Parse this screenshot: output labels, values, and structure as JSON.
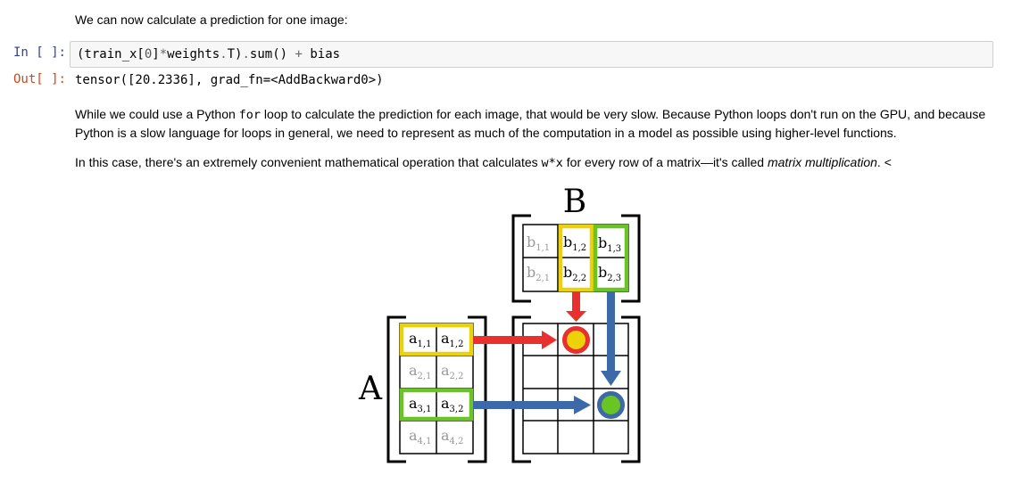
{
  "md1": {
    "text": "We can now calculate a prediction for one image:"
  },
  "cell_in": {
    "prompt": "In [ ]:",
    "code": {
      "p1": "(train_x[",
      "num": "0",
      "p2": "]",
      "op1": "*",
      "p3": "weights",
      "op2": ".",
      "p4": "T)",
      "op3": ".",
      "p5": "sum() ",
      "op4": "+",
      "p6": " bias"
    }
  },
  "cell_out": {
    "prompt": "Out[ ]:",
    "text": "tensor([20.2336], grad_fn=<AddBackward0>)"
  },
  "md2": {
    "part1": "While we could use a Python ",
    "code": "for",
    "part2": " loop to calculate the prediction for each image, that would be very slow. Because Python loops don't run on the GPU, and because Python is a slow language for loops in general, we need to represent as much of the computation in a model as possible using higher-level functions."
  },
  "md3": {
    "part1": "In this case, there's an extremely convenient mathematical operation that calculates ",
    "code": "w*x",
    "part2": " for every row of a matrix—it's called ",
    "em": "matrix multiplication",
    "part3": ". <"
  },
  "diagram": {
    "label_A": "A",
    "label_B": "B",
    "b11": {
      "base": "b",
      "sub": "1,1"
    },
    "b12": {
      "base": "b",
      "sub": "1,2"
    },
    "b13": {
      "base": "b",
      "sub": "1,3"
    },
    "b21": {
      "base": "b",
      "sub": "2,1"
    },
    "b22": {
      "base": "b",
      "sub": "2,2"
    },
    "b23": {
      "base": "b",
      "sub": "2,3"
    },
    "a11": {
      "base": "a",
      "sub": "1,1"
    },
    "a12": {
      "base": "a",
      "sub": "1,2"
    },
    "a21": {
      "base": "a",
      "sub": "2,1"
    },
    "a22": {
      "base": "a",
      "sub": "2,2"
    },
    "a31": {
      "base": "a",
      "sub": "3,1"
    },
    "a32": {
      "base": "a",
      "sub": "3,2"
    },
    "a41": {
      "base": "a",
      "sub": "4,1"
    },
    "a42": {
      "base": "a",
      "sub": "4,2"
    },
    "colors": {
      "highlight_yellow": "#ecd20a",
      "highlight_green": "#6ac425",
      "arrow_red": "#e8302e",
      "arrow_blue": "#3c69a8",
      "dim_text": "#999999"
    }
  }
}
